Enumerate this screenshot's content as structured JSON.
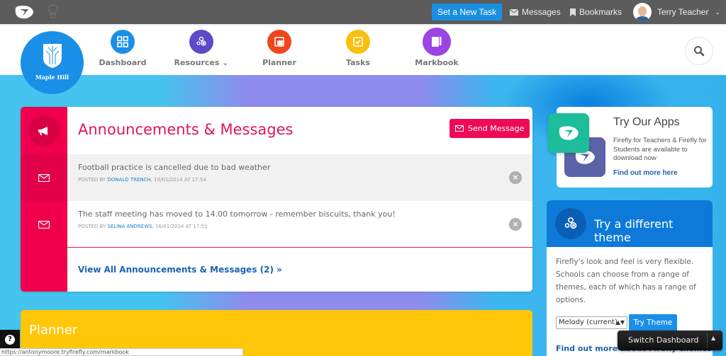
{
  "topbar": {
    "new_task_label": "Set a New Task",
    "messages_label": "Messages",
    "bookmarks_label": "Bookmarks",
    "user_name": "Terry Teacher"
  },
  "school": {
    "name": "Maple Hill"
  },
  "nav": {
    "items": [
      {
        "label": "Dashboard",
        "color": "#1a8fe8"
      },
      {
        "label": "Resources",
        "color": "#5b4bc8"
      },
      {
        "label": "Planner",
        "color": "#f0461e"
      },
      {
        "label": "Tasks",
        "color": "#fbbf0f"
      },
      {
        "label": "Markbook",
        "color": "#9c44e4"
      }
    ]
  },
  "announcements": {
    "title": "Announcements & Messages",
    "send_label": "Send Message",
    "posted_by_prefix": "POSTED BY",
    "messages": [
      {
        "text": "Football practice is cancelled due to bad weather",
        "author": "DONALD TRENCH",
        "when": ", 16/01/2014 AT 17:54"
      },
      {
        "text": "The staff meeting has moved to 14.00 tomorrow - remember biscuits, thank you!",
        "author": "SELINA ANDREWS",
        "when": ", 16/01/2014 AT 17:51"
      }
    ],
    "view_all_label": "View All Announcements & Messages (2) »"
  },
  "apps": {
    "title": "Try Our Apps",
    "description": "Firefly for Teachers & Firefly for Students are available to download now",
    "link_label": "Find out more here"
  },
  "theme": {
    "title": "Try a different theme",
    "description": "Firefly's look and feel is very flexible. Schools can choose from a range of themes, each of which has a range of options.",
    "selected_theme": "Melody (current)",
    "try_label": "Try Theme",
    "more_label": "Find out more about Firefly themes"
  },
  "switch_dashboard_label": "Switch Dashboard",
  "planner": {
    "title": "Planner"
  },
  "status_url": "https://antonymoore.tryfirefly.com/markbook",
  "colors": {
    "accent_pink": "#f0004c",
    "accent_blue": "#1a8fe8",
    "planner_yellow": "#ffc60a"
  }
}
